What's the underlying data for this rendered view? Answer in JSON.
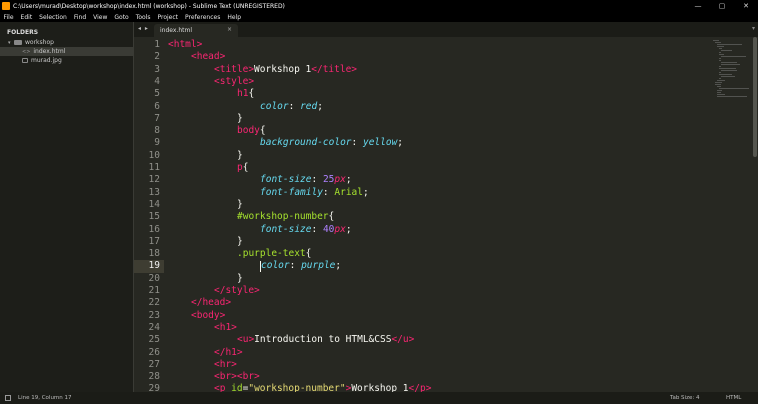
{
  "window": {
    "title": "C:\\Users\\murad\\Desktop\\workshop\\index.html (workshop) - Sublime Text (UNREGISTERED)",
    "controls": {
      "minimize": "—",
      "maximize": "▢",
      "close": "✕"
    }
  },
  "menu": [
    "File",
    "Edit",
    "Selection",
    "Find",
    "View",
    "Goto",
    "Tools",
    "Project",
    "Preferences",
    "Help"
  ],
  "sidebar": {
    "header": "FOLDERS",
    "folder": "workshop",
    "files": [
      {
        "name": "index.html",
        "active": true
      },
      {
        "name": "murad.jpg",
        "active": false
      }
    ]
  },
  "tabs": {
    "nav": "◂ ▸",
    "active": {
      "name": "index.html",
      "close": "×"
    },
    "right_controls": "▾"
  },
  "editor": {
    "current_line": 19,
    "lines": [
      {
        "n": "1",
        "tokens": [
          [
            "tag",
            "<html>"
          ]
        ],
        "indent": 0
      },
      {
        "n": "2",
        "tokens": [
          [
            "tag",
            "<head>"
          ]
        ],
        "indent": 1
      },
      {
        "n": "3",
        "tokens": [
          [
            "tag",
            "<title>"
          ],
          [
            "text",
            "Workshop 1"
          ],
          [
            "tag",
            "</title>"
          ]
        ],
        "indent": 2
      },
      {
        "n": "4",
        "tokens": [
          [
            "tag",
            "<style>"
          ]
        ],
        "indent": 2
      },
      {
        "n": "5",
        "tokens": [
          [
            "sel",
            "h1"
          ],
          [
            "punct",
            "{"
          ]
        ],
        "indent": 3
      },
      {
        "n": "6",
        "tokens": [
          [
            "prop",
            "color"
          ],
          [
            "punct",
            ": "
          ],
          [
            "val",
            "red"
          ],
          [
            "punct",
            ";"
          ]
        ],
        "indent": 4
      },
      {
        "n": "7",
        "tokens": [
          [
            "punct",
            "}"
          ]
        ],
        "indent": 3
      },
      {
        "n": "8",
        "tokens": [
          [
            "sel",
            "body"
          ],
          [
            "punct",
            "{"
          ]
        ],
        "indent": 3
      },
      {
        "n": "9",
        "tokens": [
          [
            "prop",
            "background-color"
          ],
          [
            "punct",
            ": "
          ],
          [
            "val",
            "yellow"
          ],
          [
            "punct",
            ";"
          ]
        ],
        "indent": 4
      },
      {
        "n": "10",
        "tokens": [
          [
            "punct",
            "}"
          ]
        ],
        "indent": 3
      },
      {
        "n": "11",
        "tokens": [
          [
            "sel",
            "p"
          ],
          [
            "punct",
            "{"
          ]
        ],
        "indent": 3
      },
      {
        "n": "12",
        "tokens": [
          [
            "prop",
            "font-size"
          ],
          [
            "punct",
            ": "
          ],
          [
            "num",
            "25"
          ],
          [
            "unit",
            "px"
          ],
          [
            "punct",
            ";"
          ]
        ],
        "indent": 4
      },
      {
        "n": "13",
        "tokens": [
          [
            "prop",
            "font-family"
          ],
          [
            "punct",
            ": "
          ],
          [
            "attr",
            "Arial"
          ],
          [
            "punct",
            ";"
          ]
        ],
        "indent": 4
      },
      {
        "n": "14",
        "tokens": [
          [
            "punct",
            "}"
          ]
        ],
        "indent": 3
      },
      {
        "n": "15",
        "tokens": [
          [
            "attr",
            "#workshop-number"
          ],
          [
            "punct",
            "{"
          ]
        ],
        "indent": 3
      },
      {
        "n": "16",
        "tokens": [
          [
            "prop",
            "font-size"
          ],
          [
            "punct",
            ": "
          ],
          [
            "num",
            "40"
          ],
          [
            "unit",
            "px"
          ],
          [
            "punct",
            ";"
          ]
        ],
        "indent": 4
      },
      {
        "n": "17",
        "tokens": [
          [
            "punct",
            "}"
          ]
        ],
        "indent": 3
      },
      {
        "n": "18",
        "tokens": [
          [
            "attr",
            ".purple-text"
          ],
          [
            "punct",
            "{"
          ]
        ],
        "indent": 3
      },
      {
        "n": "19",
        "tokens": [
          [
            "cursor",
            ""
          ],
          [
            "prop",
            "color"
          ],
          [
            "punct",
            ": "
          ],
          [
            "val",
            "purple"
          ],
          [
            "punct",
            ";"
          ]
        ],
        "indent": 4
      },
      {
        "n": "20",
        "tokens": [
          [
            "punct",
            "}"
          ]
        ],
        "indent": 3
      },
      {
        "n": "21",
        "tokens": [
          [
            "tag",
            "</style>"
          ]
        ],
        "indent": 2
      },
      {
        "n": "22",
        "tokens": [
          [
            "tag",
            "</head>"
          ]
        ],
        "indent": 1
      },
      {
        "n": "23",
        "tokens": [
          [
            "tag",
            "<body>"
          ]
        ],
        "indent": 1
      },
      {
        "n": "24",
        "tokens": [
          [
            "tag",
            "<h1>"
          ]
        ],
        "indent": 2
      },
      {
        "n": "25",
        "tokens": [
          [
            "tag",
            "<u>"
          ],
          [
            "text",
            "Introduction to HTML&CSS"
          ],
          [
            "tag",
            "</u>"
          ]
        ],
        "indent": 3
      },
      {
        "n": "26",
        "tokens": [
          [
            "tag",
            "</h1>"
          ]
        ],
        "indent": 2
      },
      {
        "n": "27",
        "tokens": [
          [
            "tag",
            "<hr>"
          ]
        ],
        "indent": 2
      },
      {
        "n": "28",
        "tokens": [
          [
            "tag",
            "<br><br>"
          ]
        ],
        "indent": 2
      },
      {
        "n": "29",
        "tokens": [
          [
            "tag",
            "<p "
          ],
          [
            "attr",
            "id"
          ],
          [
            "punct",
            "="
          ],
          [
            "str",
            "\"workshop-number\""
          ],
          [
            "tag",
            ">"
          ],
          [
            "text",
            "Workshop 1"
          ],
          [
            "tag",
            "</p>"
          ]
        ],
        "indent": 2
      }
    ]
  },
  "status": {
    "position": "Line 19, Column 17",
    "tab_size": "Tab Size: 4",
    "syntax": "HTML"
  }
}
